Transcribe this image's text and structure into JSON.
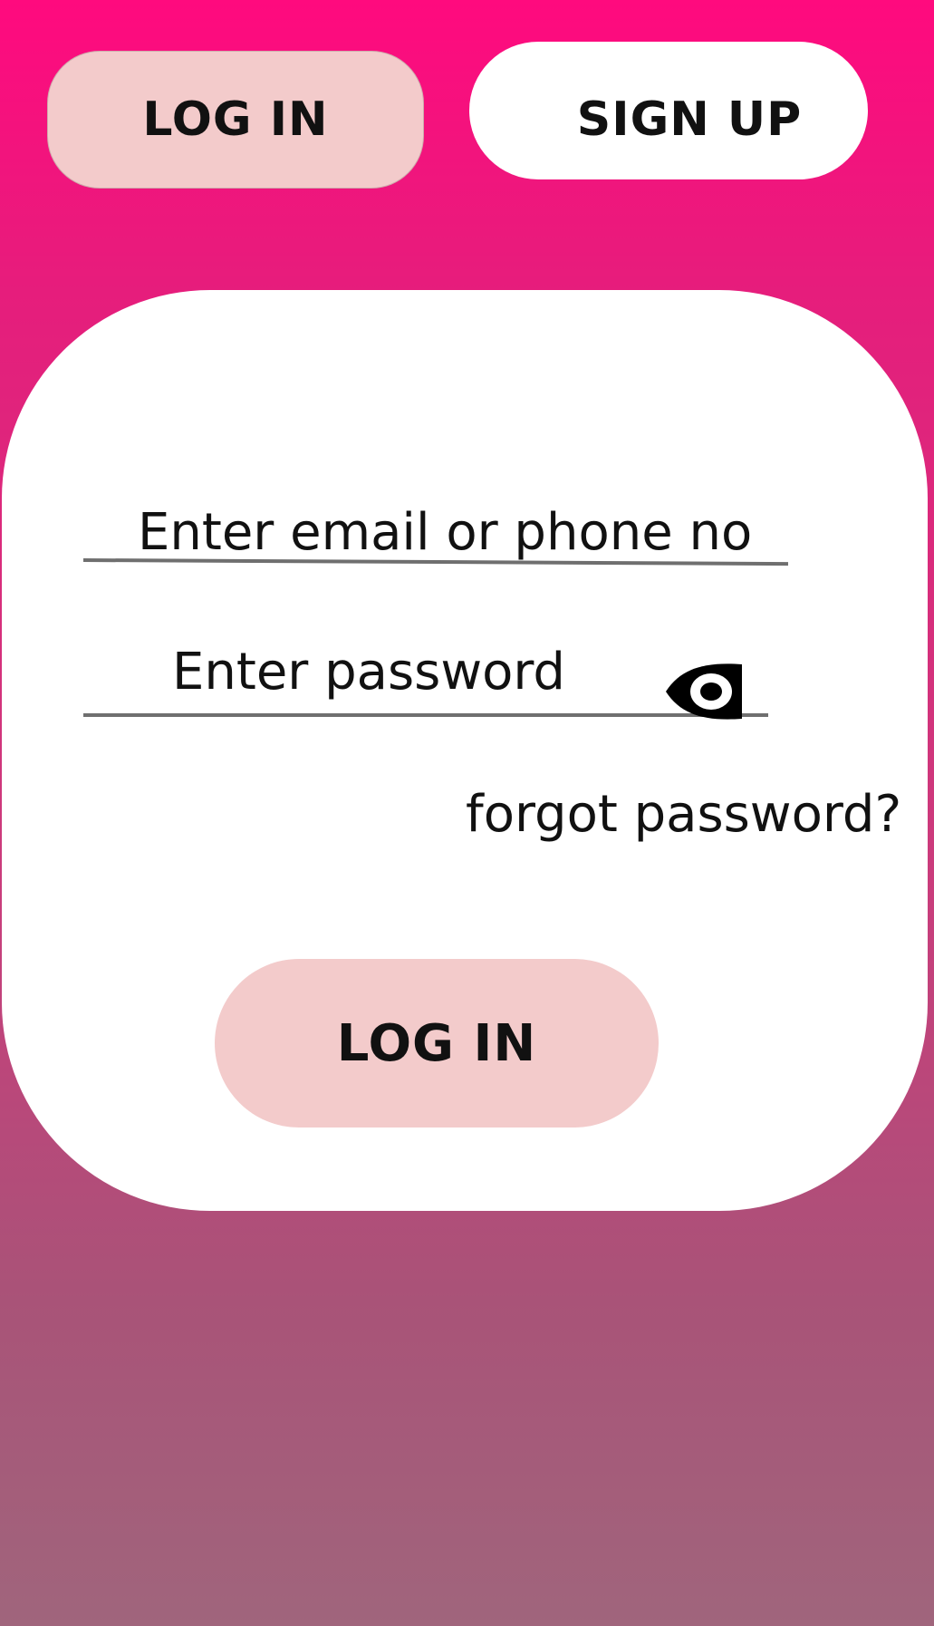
{
  "tabs": {
    "login_label": "LOG IN",
    "signup_label": "SIGN UP"
  },
  "form": {
    "email_placeholder": "Enter email or phone no",
    "password_placeholder": "Enter password",
    "password_toggle_icon": "eye-icon",
    "forgot_password_label": "forgot password?",
    "submit_label": "LOG IN"
  },
  "colors": {
    "background_top": "#ff0a7e",
    "background_bottom": "#a0657c",
    "button_fill": "#f3cbcb",
    "card_fill": "#ffffff",
    "underline": "#6f6f6f"
  }
}
